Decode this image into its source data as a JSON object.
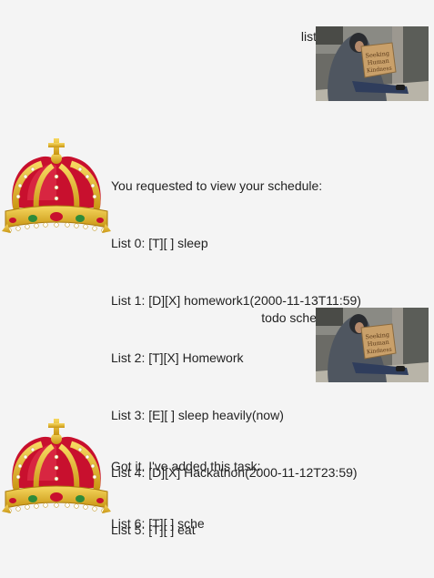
{
  "chat": {
    "messages": [
      {
        "sender": "user",
        "text": "list",
        "avatar": "homeless-person-with-sign-photo",
        "sign_text": "Seeking Human Kindness"
      },
      {
        "sender": "bot",
        "avatar": "royal-crown-icon",
        "lines": [
          "You requested to view your schedule:",
          "List 0: [T][ ] sleep",
          "List 1: [D][X] homework1(2000-11-13T11:59)",
          "List 2: [T][X] Homework",
          "List 3: [E][ ] sleep heavily(now)",
          "List 4: [D][X] Hackathon(2000-11-12T23:59)",
          "List 5: [T][ ] eat"
        ]
      },
      {
        "sender": "user",
        "text": "todo sche",
        "avatar": "homeless-person-with-sign-photo",
        "sign_text": "Seeking Human Kindness"
      },
      {
        "sender": "bot",
        "avatar": "royal-crown-icon",
        "lines": [
          "Got it. I've added this task:",
          "List 6: [T][ ] sche"
        ]
      }
    ]
  },
  "colors": {
    "background": "#f4f4f4",
    "text": "#222222",
    "crown_gold": "#e0b020",
    "crown_red": "#c8102e"
  }
}
